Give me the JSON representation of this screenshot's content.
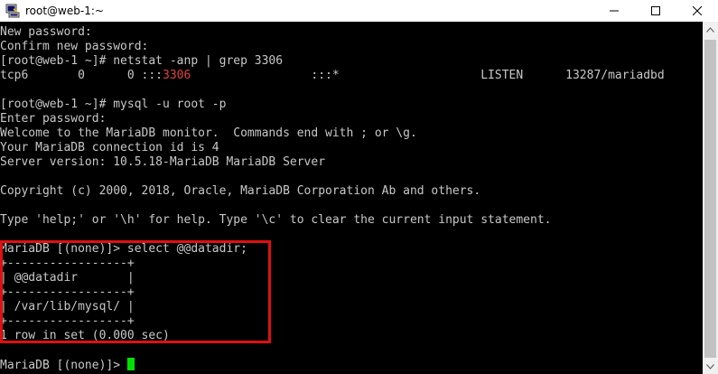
{
  "window": {
    "title": "root@web-1:~",
    "icon": "putty-terminal-icon"
  },
  "controls": {
    "minimize_icon": "minimize-icon",
    "maximize_icon": "maximize-icon",
    "close_icon": "close-icon"
  },
  "terminal": {
    "lines": [
      "New password:",
      "Confirm new password:",
      "[root@web-1 ~]# netstat -anp | grep 3306",
      "",
      "",
      "[root@web-1 ~]# mysql -u root -p",
      "Enter password:",
      "Welcome to the MariaDB monitor.  Commands end with ; or \\g.",
      "Your MariaDB connection id is 4",
      "Server version: 10.5.18-MariaDB MariaDB Server",
      "",
      "Copyright (c) 2000, 2018, Oracle, MariaDB Corporation Ab and others.",
      "",
      "Type 'help;' or '\\h' for help. Type '\\c' to clear the current input statement.",
      "",
      "MariaDB [(none)]> select @@datadir;",
      "+-----------------+",
      "| @@datadir       |",
      "+-----------------+",
      "| /var/lib/mysql/ |",
      "+-----------------+",
      "1 row in set (0.000 sec)",
      "",
      "MariaDB [(none)]> "
    ],
    "netstat_prefix": "tcp6       0      0 :::",
    "netstat_port": "3306",
    "netstat_suffix": "                 :::*                    LISTEN      13287/mariadbd",
    "cursor_color": "#00e000",
    "text_color": "#c8c8c8",
    "port_color": "#e04040",
    "highlight_color": "#e01010"
  }
}
